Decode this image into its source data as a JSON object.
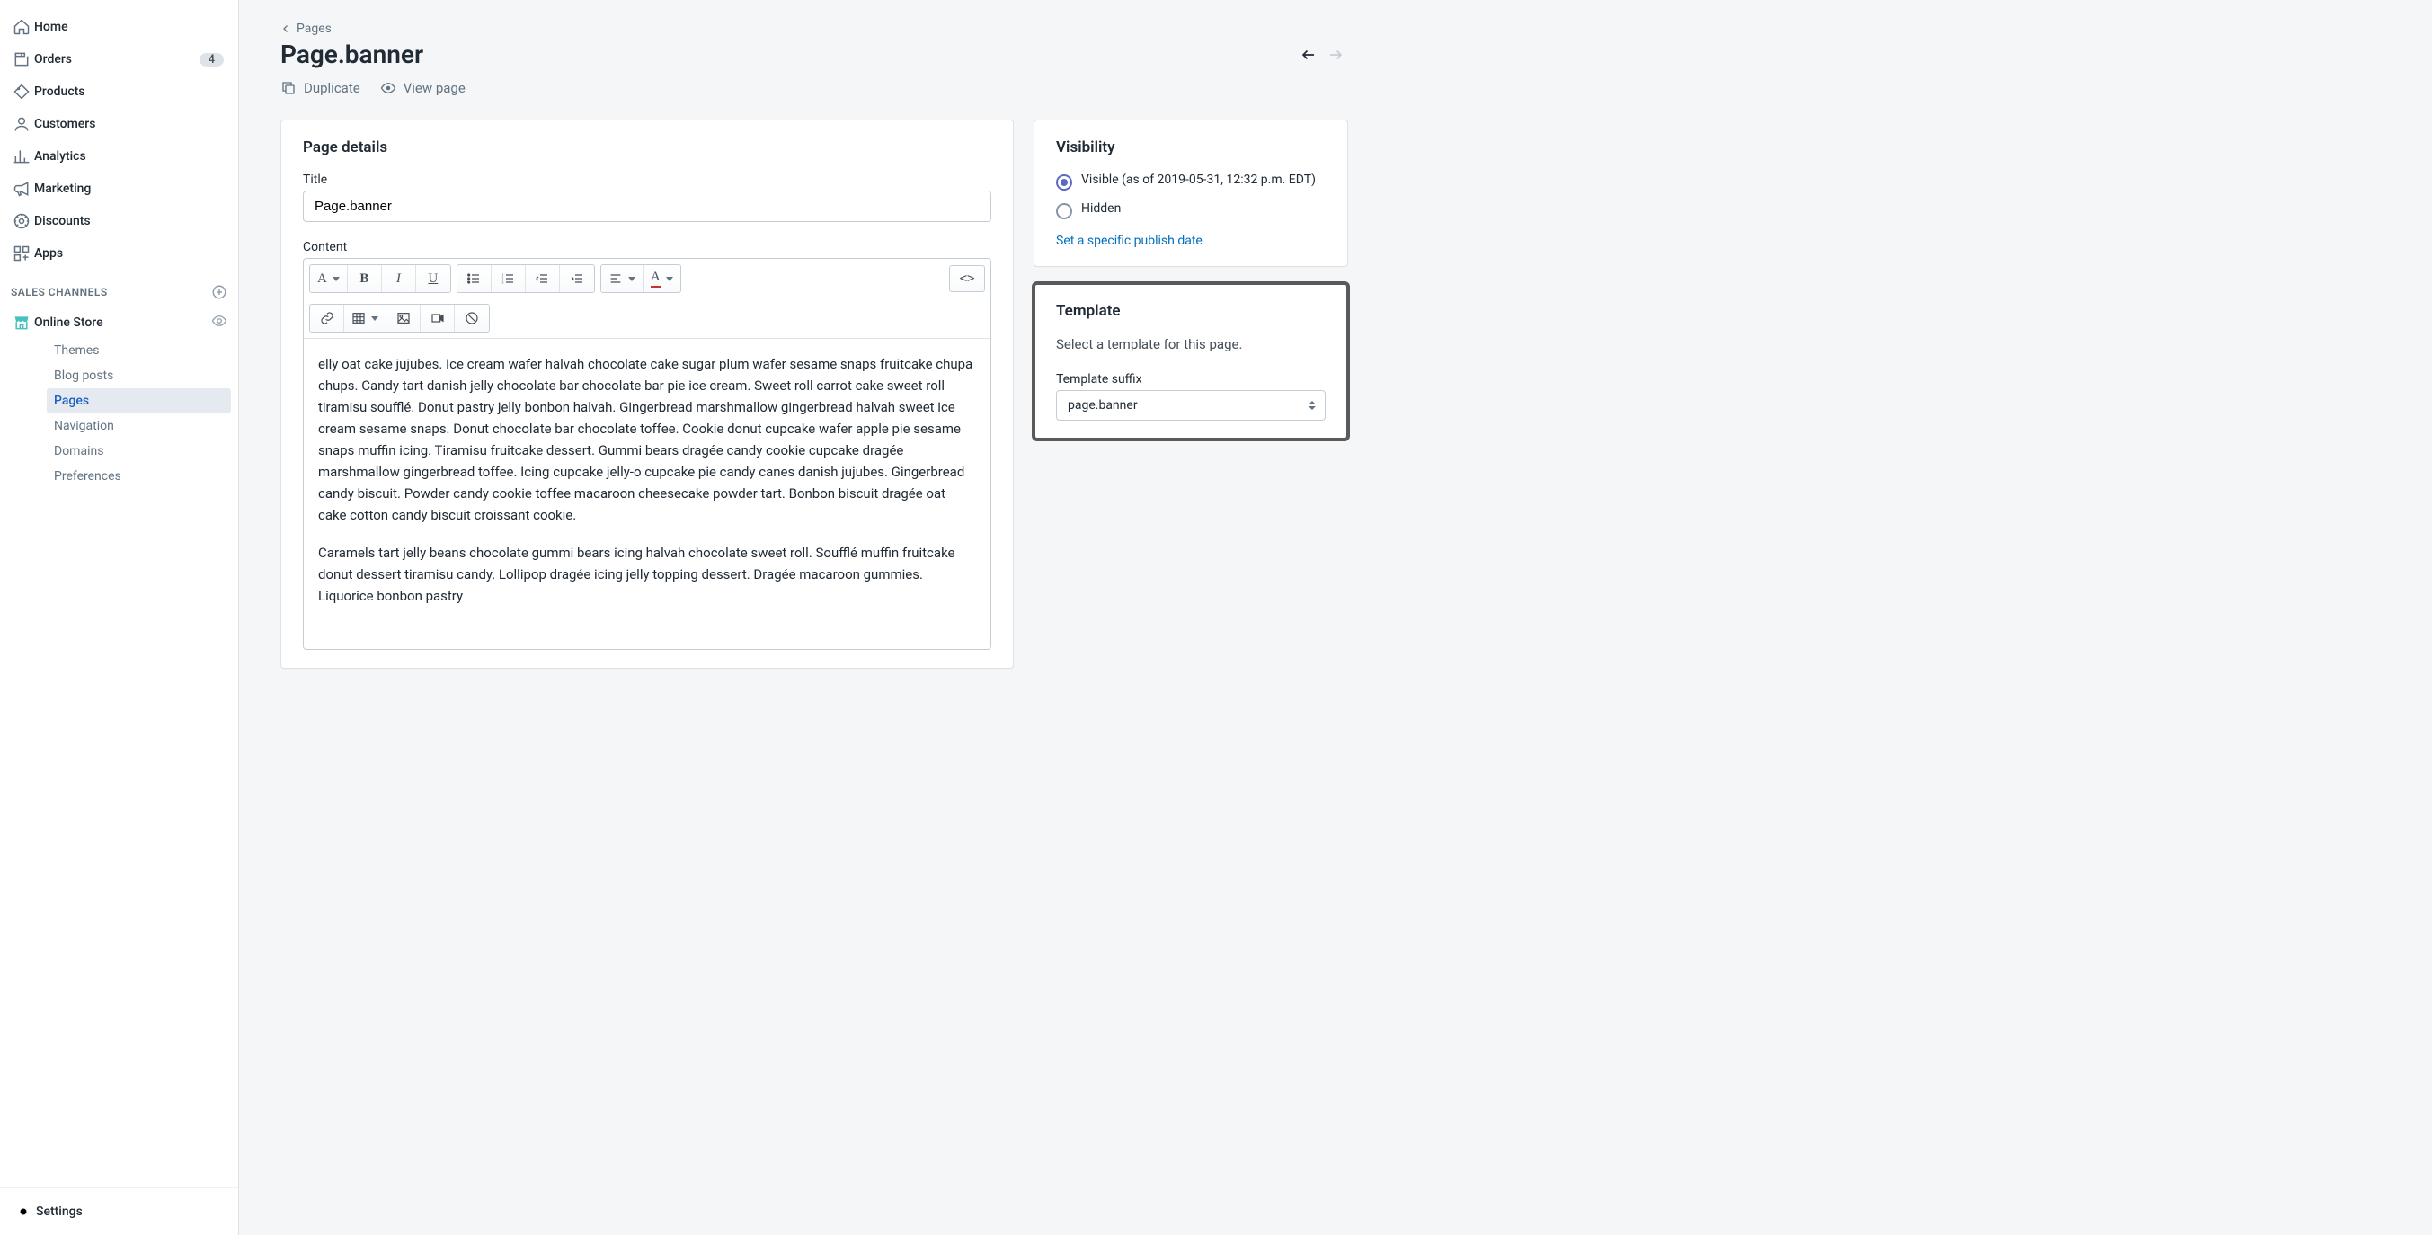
{
  "sidebar": {
    "nav": [
      {
        "label": "Home",
        "icon": "home"
      },
      {
        "label": "Orders",
        "icon": "orders",
        "badge": "4"
      },
      {
        "label": "Products",
        "icon": "products"
      },
      {
        "label": "Customers",
        "icon": "customers"
      },
      {
        "label": "Analytics",
        "icon": "analytics"
      },
      {
        "label": "Marketing",
        "icon": "marketing"
      },
      {
        "label": "Discounts",
        "icon": "discounts"
      },
      {
        "label": "Apps",
        "icon": "apps"
      }
    ],
    "section_label": "SALES CHANNELS",
    "channel": "Online Store",
    "subnav": [
      {
        "label": "Themes",
        "active": false
      },
      {
        "label": "Blog posts",
        "active": false
      },
      {
        "label": "Pages",
        "active": true
      },
      {
        "label": "Navigation",
        "active": false
      },
      {
        "label": "Domains",
        "active": false
      },
      {
        "label": "Preferences",
        "active": false
      }
    ],
    "settings_label": "Settings"
  },
  "breadcrumb": {
    "label": "Pages"
  },
  "page_title": "Page.banner",
  "actions": {
    "duplicate": "Duplicate",
    "view_page": "View page"
  },
  "page_details": {
    "heading": "Page details",
    "title_label": "Title",
    "title_value": "Page.banner",
    "content_label": "Content",
    "code_btn": "<>",
    "paragraphs": [
      "elly oat cake jujubes. Ice cream wafer halvah chocolate cake sugar plum wafer sesame snaps fruitcake chupa chups. Candy tart danish jelly chocolate bar chocolate bar pie ice cream. Sweet roll carrot cake sweet roll tiramisu soufflé. Donut pastry jelly bonbon halvah. Gingerbread marshmallow gingerbread halvah sweet ice cream sesame snaps. Donut chocolate bar chocolate toffee. Cookie donut cupcake wafer apple pie sesame snaps muffin icing. Tiramisu fruitcake dessert. Gummi bears dragée candy cookie cupcake dragée marshmallow gingerbread toffee. Icing cupcake jelly-o cupcake pie candy canes danish jujubes. Gingerbread candy biscuit. Powder candy cookie toffee macaroon cheesecake powder tart. Bonbon biscuit dragée oat cake cotton candy biscuit croissant cookie.",
      "Caramels tart jelly beans chocolate gummi bears icing halvah chocolate sweet roll. Soufflé muffin fruitcake donut dessert tiramisu candy. Lollipop dragée icing jelly topping dessert. Dragée macaroon gummies. Liquorice bonbon pastry"
    ]
  },
  "visibility": {
    "heading": "Visibility",
    "visible_label": "Visible (as of 2019-05-31, 12:32 p.m. EDT)",
    "hidden_label": "Hidden",
    "link": "Set a specific publish date"
  },
  "template": {
    "heading": "Template",
    "help": "Select a template for this page.",
    "suffix_label": "Template suffix",
    "suffix_value": "page.banner"
  }
}
